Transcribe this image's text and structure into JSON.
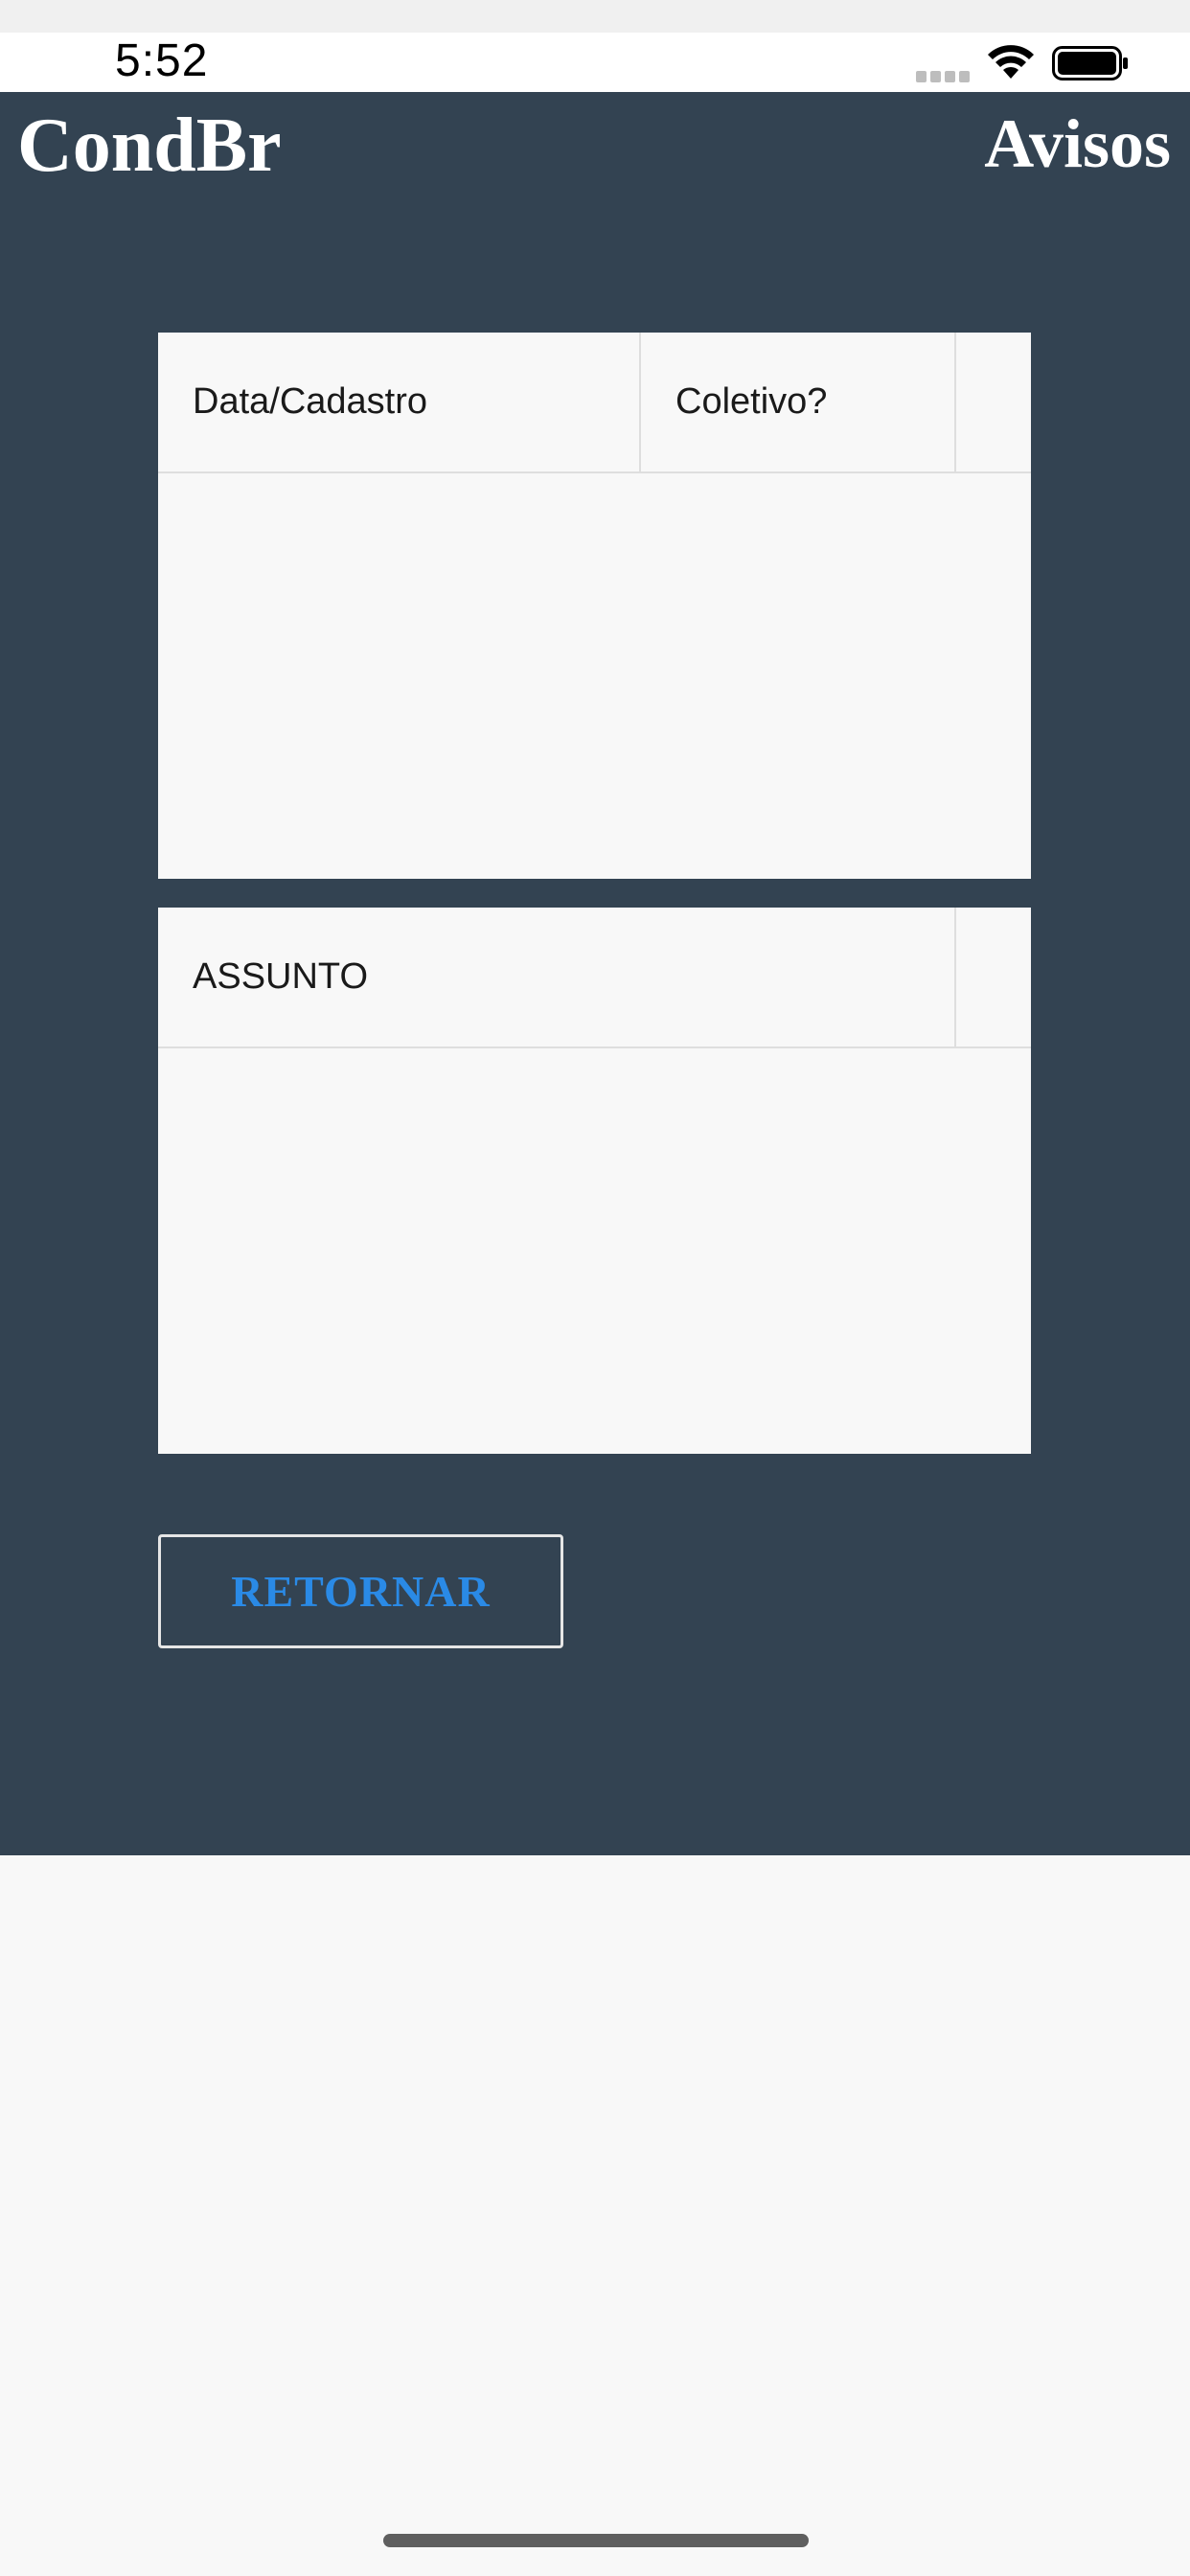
{
  "status_bar": {
    "time": "5:52",
    "icons": [
      "signal-icon",
      "wifi-icon",
      "battery-icon"
    ]
  },
  "header": {
    "brand": "CondBr",
    "title": "Avisos"
  },
  "table_top": {
    "columns": [
      "Data/Cadastro",
      "Coletivo?",
      ""
    ],
    "rows": []
  },
  "table_bottom": {
    "columns": [
      "ASSUNTO",
      ""
    ],
    "rows": []
  },
  "actions": {
    "return_label": "RETORNAR"
  },
  "colors": {
    "header_bg": "#334352",
    "page_bg": "#f8f8f8",
    "button_text": "#2a8ae6"
  }
}
